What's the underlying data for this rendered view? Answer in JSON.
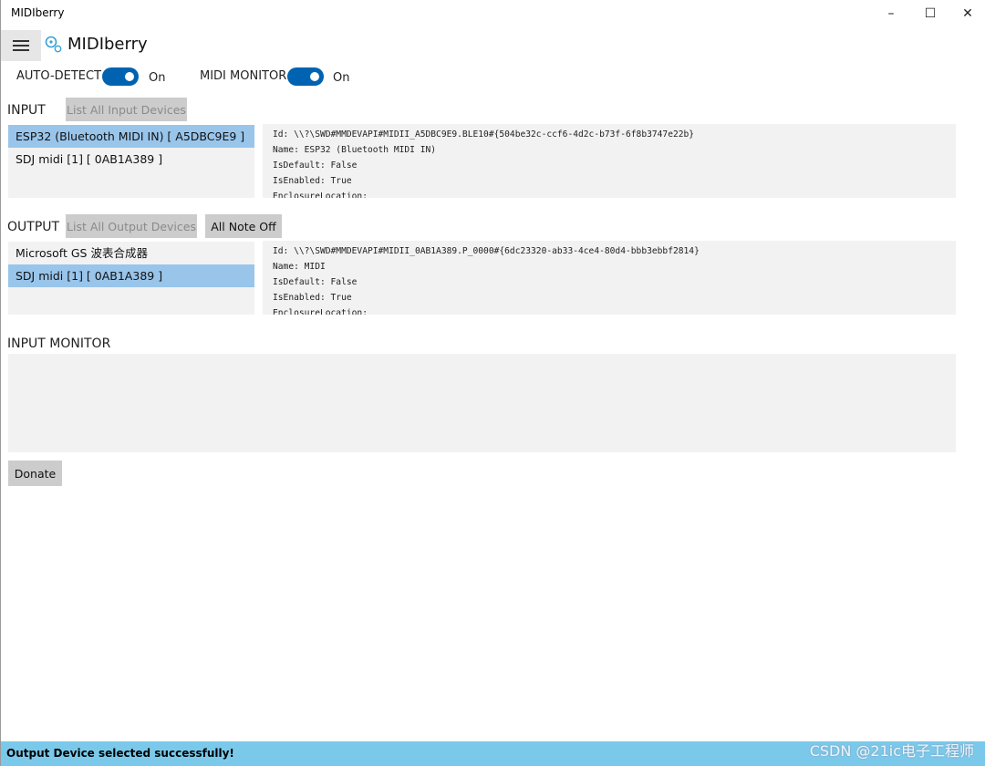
{
  "window": {
    "title": "MIDIberry",
    "controls": {
      "minimize": "–",
      "maximize": "☐",
      "close": "✕"
    }
  },
  "header": {
    "menu_icon": "hamburger-icon",
    "logo_icon": "midiberry-logo-icon",
    "app_title": "MIDIberry"
  },
  "toggles": {
    "auto_detect": {
      "label": "AUTO-DETECT",
      "state": "On",
      "on": true
    },
    "midi_monitor": {
      "label": "MIDI MONITOR",
      "state": "On",
      "on": true
    }
  },
  "input": {
    "label": "INPUT",
    "list_button": "List All Input Devices",
    "devices": [
      {
        "name": "ESP32 (Bluetooth MIDI IN) [ A5DBC9E9 ]",
        "selected": true
      },
      {
        "name": "SDJ midi [1] [ 0AB1A389 ]",
        "selected": false
      }
    ],
    "details": [
      "Id: \\\\?\\SWD#MMDEVAPI#MIDII_A5DBC9E9.BLE10#{504be32c-ccf6-4d2c-b73f-6f8b3747e22b}",
      "Name: ESP32 (Bluetooth MIDI IN)",
      "IsDefault: False",
      "IsEnabled: True",
      "EnclosureLocation:"
    ]
  },
  "output": {
    "label": "OUTPUT",
    "list_button": "List All Output Devices",
    "note_off_button": "All Note Off",
    "devices": [
      {
        "name": "Microsoft GS 波表合成器",
        "selected": false
      },
      {
        "name": "SDJ midi [1] [ 0AB1A389 ]",
        "selected": true
      }
    ],
    "details": [
      "Id: \\\\?\\SWD#MMDEVAPI#MIDII_0AB1A389.P_0000#{6dc23320-ab33-4ce4-80d4-bbb3ebbf2814}",
      "Name: MIDI",
      "IsDefault: False",
      "IsEnabled: True",
      "EnclosureLocation:"
    ]
  },
  "input_monitor": {
    "label": "INPUT MONITOR"
  },
  "donate_button": "Donate",
  "status": {
    "message": "Output Device selected successfully!",
    "watermark": "CSDN @21ic电子工程师"
  },
  "colors": {
    "accent": "#0063b1",
    "selection": "#99c5eb",
    "status_bar": "#7bc9ea",
    "panel": "#f2f2f2",
    "button": "#cccccc"
  }
}
